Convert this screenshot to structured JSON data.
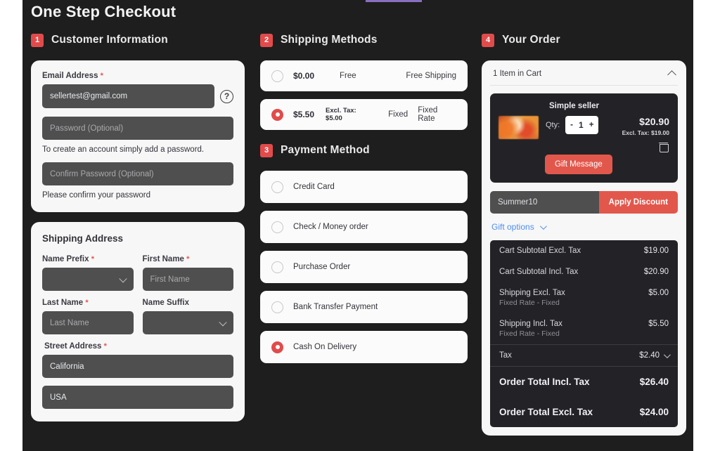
{
  "page": {
    "title": "One Step Checkout"
  },
  "sections": {
    "customer": {
      "step": "1",
      "title": "Customer Information"
    },
    "shipping_methods": {
      "step": "2",
      "title": "Shipping Methods"
    },
    "payment": {
      "step": "3",
      "title": "Payment Method"
    },
    "order": {
      "step": "4",
      "title": "Your Order"
    }
  },
  "customer_form": {
    "email_label": "Email Address",
    "email_value": "sellertest@gmail.com",
    "help_icon": "question-circle-icon",
    "password_placeholder": "Password (Optional)",
    "password_hint": "To create an account simply add a password.",
    "confirm_placeholder": "Confirm Password (Optional)",
    "confirm_hint": "Please confirm your password"
  },
  "shipping_address": {
    "title": "Shipping Address",
    "name_prefix_label": "Name Prefix",
    "name_prefix_value": "",
    "first_name_label": "First Name",
    "first_name_placeholder": "First Name",
    "last_name_label": "Last Name",
    "last_name_placeholder": "Last Name",
    "name_suffix_label": "Name Suffix",
    "name_suffix_value": "",
    "street_label": "Street Address",
    "street_line1": "California",
    "street_line2": "USA"
  },
  "shipping_methods": [
    {
      "price": "$0.00",
      "excl": "",
      "method": "Free",
      "carrier": "Free Shipping",
      "selected": false
    },
    {
      "price": "$5.50",
      "excl": "Excl. Tax: $5.00",
      "method": "Fixed",
      "carrier": "Fixed Rate",
      "selected": true
    }
  ],
  "payment_methods": [
    {
      "label": "Credit Card",
      "selected": false
    },
    {
      "label": "Check / Money order",
      "selected": false
    },
    {
      "label": "Purchase Order",
      "selected": false
    },
    {
      "label": "Bank Transfer Payment",
      "selected": false
    },
    {
      "label": "Cash On Delivery",
      "selected": true
    }
  ],
  "cart": {
    "header": "1 Item in Cart",
    "collapse_icon": "chevron-up-icon",
    "item": {
      "seller": "Simple seller",
      "qty_label": "Qty:",
      "qty_minus": "-",
      "qty_value": "1",
      "qty_plus": "+",
      "price": "$20.90",
      "price_excl": "Excl. Tax: $19.00",
      "delete_icon": "trash-icon",
      "gift_button": "Gift Message"
    }
  },
  "discount": {
    "code_value": "Summer10",
    "apply_label": "Apply Discount"
  },
  "gift_options": {
    "label": "Gift options",
    "icon": "chevron-down-icon"
  },
  "totals": {
    "rows": [
      {
        "label": "Cart Subtotal Excl. Tax",
        "sub": "",
        "value": "$19.00"
      },
      {
        "label": "Cart Subtotal Incl. Tax",
        "sub": "",
        "value": "$20.90"
      },
      {
        "label": "Shipping Excl. Tax",
        "sub": "Fixed Rate - Fixed",
        "value": "$5.00"
      },
      {
        "label": "Shipping Incl. Tax",
        "sub": "Fixed Rate - Fixed",
        "value": "$5.50"
      }
    ],
    "tax": {
      "label": "Tax",
      "value": "$2.40",
      "icon": "chevron-down-icon"
    },
    "grand": [
      {
        "label": "Order Total Incl. Tax",
        "value": "$26.40"
      },
      {
        "label": "Order Total Excl. Tax",
        "value": "$24.00"
      }
    ]
  },
  "colors": {
    "accent": "#e2574c",
    "page_bg": "#1e1e1e",
    "card_bg": "#f7f7f7",
    "input_bg": "#4f4f4f",
    "link": "#4e8ff0"
  }
}
